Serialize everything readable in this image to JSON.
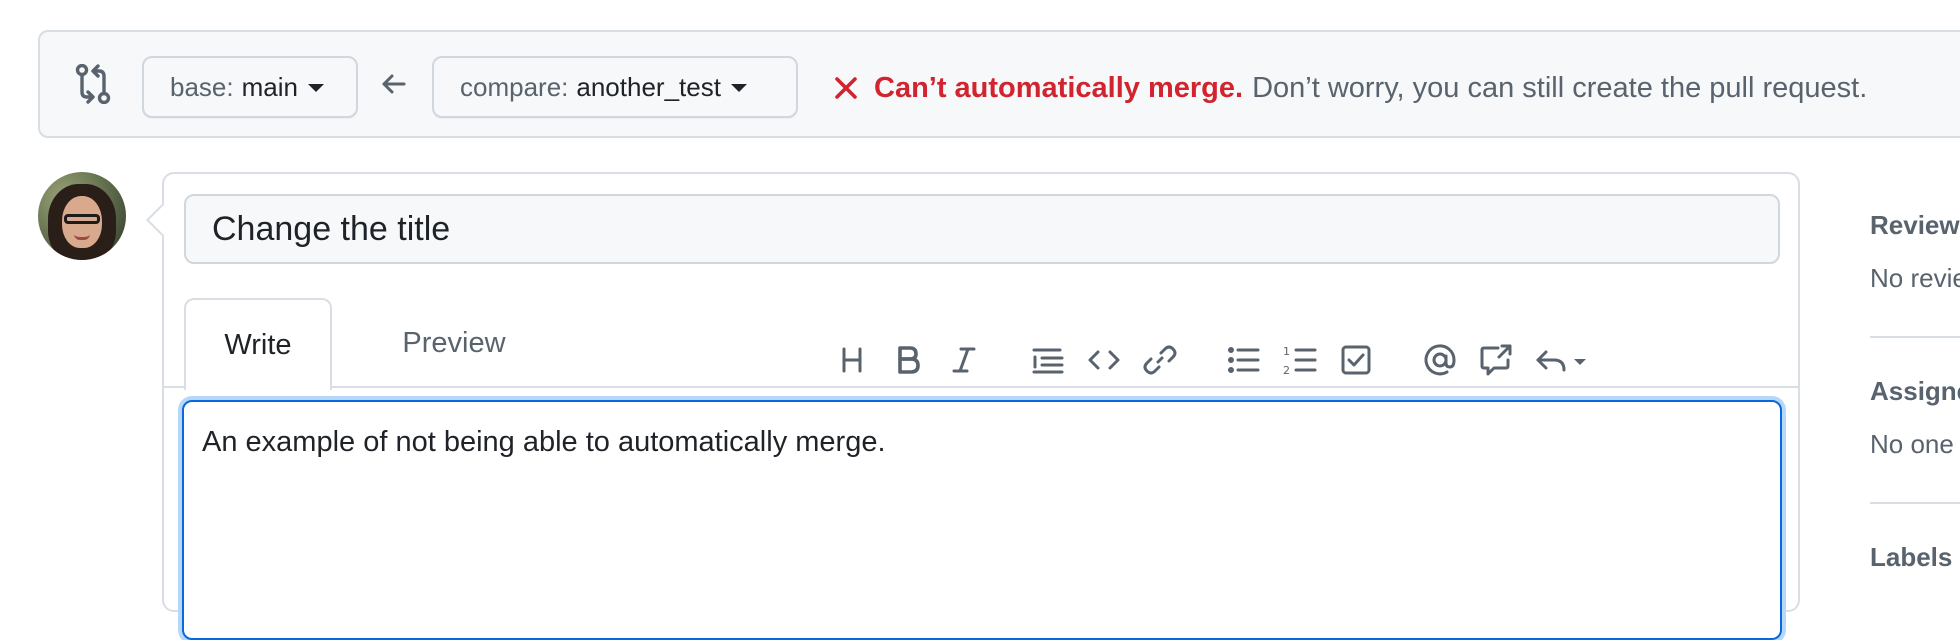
{
  "compare_bar": {
    "base": {
      "prefix": "base:",
      "branch": "main"
    },
    "compare": {
      "prefix": "compare:",
      "branch": "another_test"
    },
    "merge_status": {
      "error": "Can’t automatically merge.",
      "info": "Don’t worry, you can still create the pull request."
    }
  },
  "pr_form": {
    "title_value": "Change the title",
    "tabs": {
      "write": "Write",
      "preview": "Preview"
    },
    "body_text": "An example of not being able to automatically merge."
  },
  "toolbar": {
    "icons": [
      "heading-icon",
      "bold-icon",
      "italic-icon",
      "quote-icon",
      "code-icon",
      "link-icon",
      "unordered-list-icon",
      "ordered-list-icon",
      "task-list-icon",
      "mention-icon",
      "cross-reference-icon",
      "saved-reply-icon"
    ]
  },
  "sidebar": {
    "reviewers": {
      "title": "Reviewers",
      "value": "No reviews"
    },
    "assignees": {
      "title": "Assignees",
      "value": "No one"
    },
    "labels": {
      "title": "Labels"
    }
  },
  "colors": {
    "error": "#d1242f",
    "muted_text": "#59636e",
    "focus_border": "#0969da",
    "bar_background": "#f6f8fa",
    "border": "#d8dee4"
  }
}
